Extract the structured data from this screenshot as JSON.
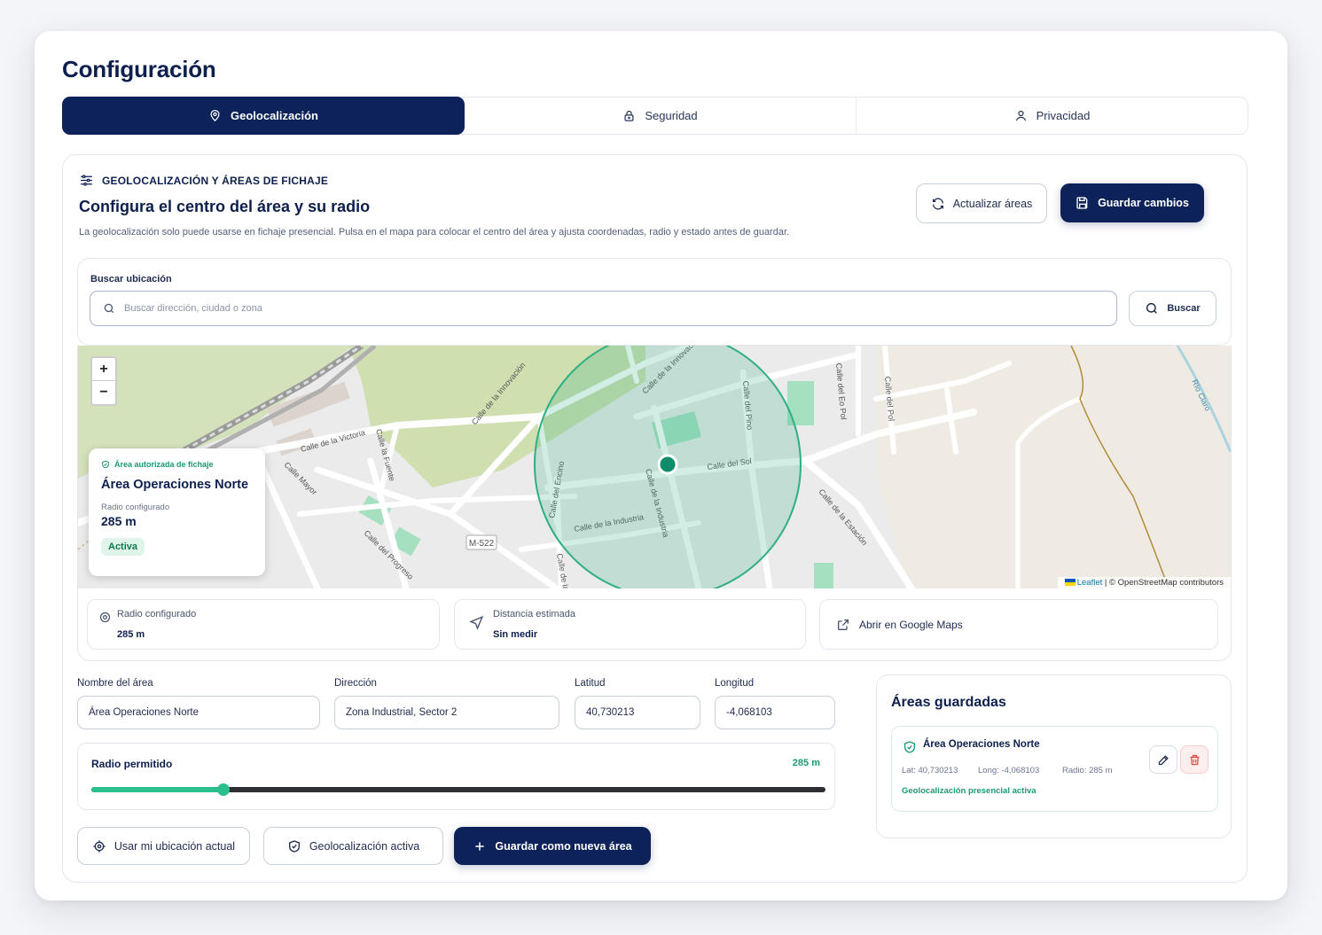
{
  "page": {
    "title": "Configuración"
  },
  "tabs": [
    {
      "label": "Geolocalización",
      "icon": "map-pin-icon",
      "active": true
    },
    {
      "label": "Seguridad",
      "icon": "lock-icon",
      "active": false
    },
    {
      "label": "Privacidad",
      "icon": "user-icon",
      "active": false
    }
  ],
  "section": {
    "kicker": "GEOLOCALIZACIÓN Y ÁREAS DE FICHAJE",
    "heading": "Configura el centro del área y su radio",
    "description": "La geolocalización solo puede usarse en fichaje presencial. Pulsa en el mapa para colocar el centro del área y ajusta coordenadas, radio y estado antes de guardar.",
    "refresh_label": "Actualizar áreas",
    "save_label": "Guardar cambios"
  },
  "search": {
    "label": "Buscar ubicación",
    "placeholder": "Buscar dirección, ciudad o zona",
    "value": "",
    "button_label": "Buscar"
  },
  "map": {
    "zoom_in": "+",
    "zoom_out": "−",
    "popup": {
      "tag": "Área autorizada de fichaje",
      "name": "Área Operaciones Norte",
      "radius_label": "Radio configurado",
      "radius_value": "285 m",
      "status": "Activa"
    },
    "attribution_link": "Leaflet",
    "attribution_text": "| © OpenStreetMap contributors",
    "streets": [
      "Calle de la Victoria",
      "Calle Mayor",
      "Calle del Progreso",
      "Calle de la Innovación",
      "Calle del Sol",
      "Calle de la Industria",
      "Calle del Encino",
      "Calle del Pino",
      "Calle de la Estación",
      "Calle del Eo Pol",
      "Calle del Pol",
      "M-522",
      "Río Claro",
      "Calle de la Ciencia",
      "Calle la Fuente"
    ],
    "colors": {
      "circle": "#2eaf84",
      "marker": "#0f8c6a"
    }
  },
  "info_cards": {
    "radius": {
      "label": "Radio configurado",
      "value": "285 m"
    },
    "distance": {
      "label": "Distancia estimada",
      "value": "Sin medir"
    },
    "maps_link": "Abrir en Google Maps"
  },
  "form": {
    "name": {
      "label": "Nombre del área",
      "value": "Área Operaciones Norte"
    },
    "address": {
      "label": "Dirección",
      "value": "Zona Industrial, Sector 2"
    },
    "lat": {
      "label": "Latitud",
      "value": "40,730213"
    },
    "lng": {
      "label": "Longitud",
      "value": "-4,068103"
    },
    "radius": {
      "label": "Radio permitido",
      "value": "285 m",
      "fraction": 0.18
    }
  },
  "actions": {
    "use_location": "Usar mi ubicación actual",
    "geo_active": "Geolocalización activa",
    "save_new": "Guardar como nueva área"
  },
  "saved_areas": {
    "title": "Áreas guardadas",
    "items": [
      {
        "name": "Área Operaciones Norte",
        "lat": "Lat: 40,730213",
        "lng": "Long: -4,068103",
        "radius": "Radio: 285 m",
        "status": "Geolocalización presencial activa"
      }
    ]
  }
}
